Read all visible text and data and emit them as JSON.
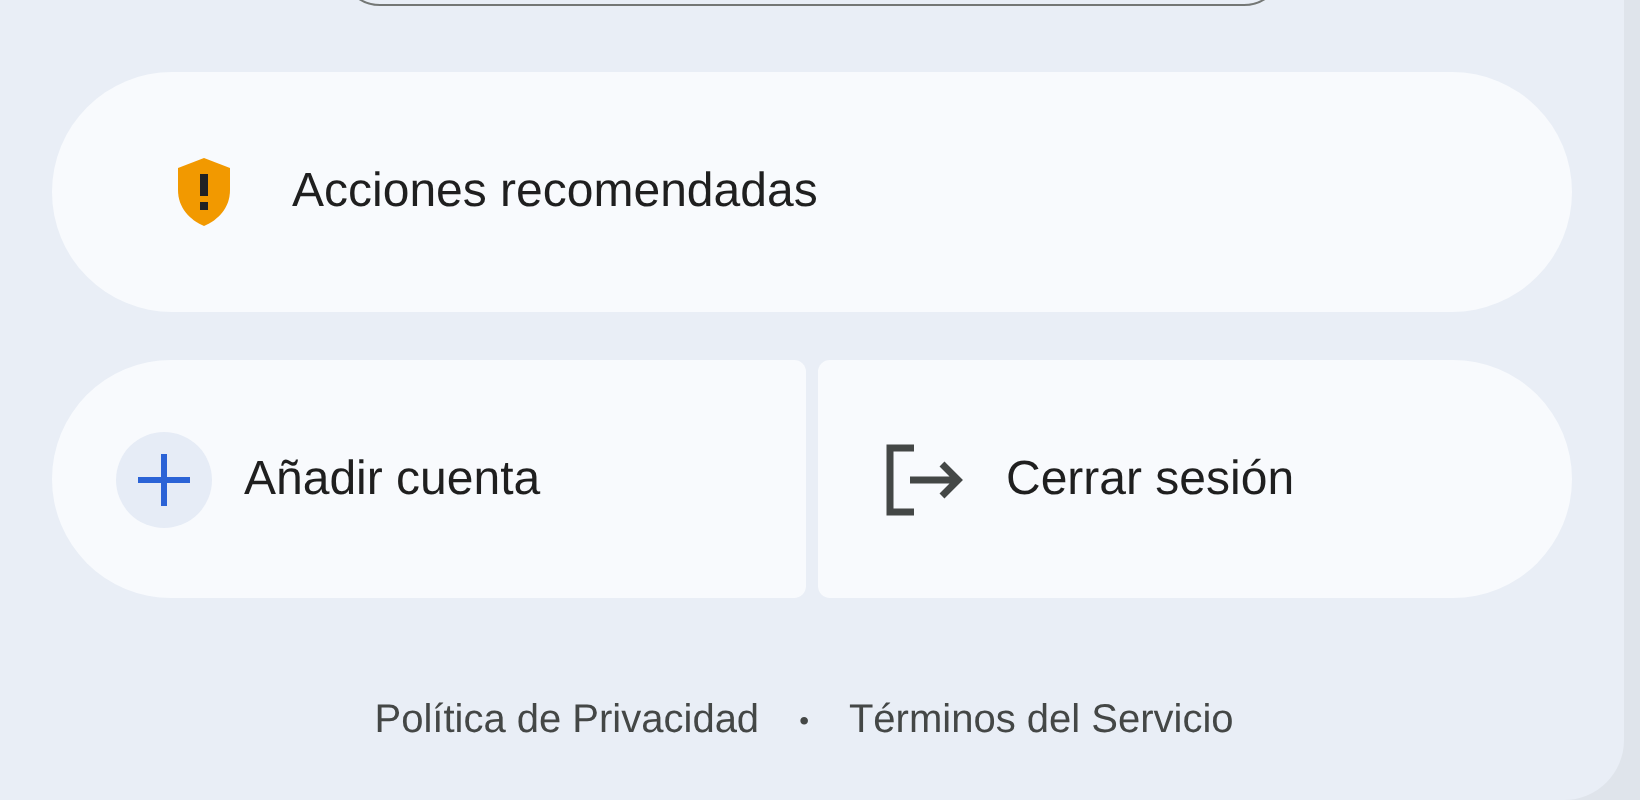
{
  "recommended_action": {
    "label": "Acciones recomendadas",
    "kind": "warning"
  },
  "account_actions": [
    {
      "label": "Añadir cuenta",
      "kind": "add"
    },
    {
      "label": "Cerrar sesión",
      "kind": "signout"
    }
  ],
  "footer": {
    "links": [
      "Política de Privacidad",
      "Términos del Servicio"
    ],
    "separator": "•"
  }
}
